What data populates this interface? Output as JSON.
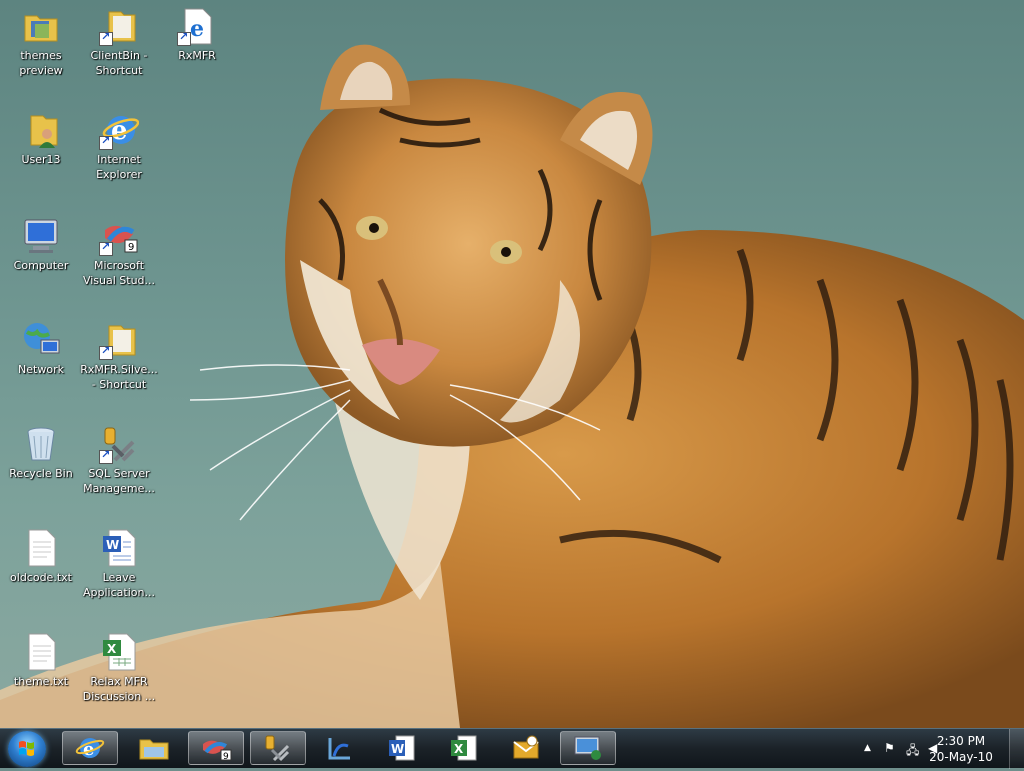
{
  "desktop": {
    "icons": [
      {
        "name": "themes preview",
        "label": "themes\npreview",
        "type": "folder"
      },
      {
        "name": "ClientBin - Shortcut",
        "label": "ClientBin -\nShortcut",
        "type": "folder-shortcut"
      },
      {
        "name": "RxMFR",
        "label": "RxMFR",
        "type": "ie-shortcut"
      },
      {
        "name": "User13",
        "label": "User13",
        "type": "user-folder"
      },
      {
        "name": "Internet Explorer",
        "label": "Internet\nExplorer",
        "type": "ie"
      },
      {
        "name": "Computer",
        "label": "Computer",
        "type": "computer"
      },
      {
        "name": "Microsoft Visual Studio",
        "label": "Microsoft\nVisual Stud...",
        "type": "vs-shortcut"
      },
      {
        "name": "Network",
        "label": "Network",
        "type": "network"
      },
      {
        "name": "RxMFR.Silve... - Shortcut",
        "label": "RxMFR.Silve...\n- Shortcut",
        "type": "folder-shortcut"
      },
      {
        "name": "Recycle Bin",
        "label": "Recycle Bin",
        "type": "recycle"
      },
      {
        "name": "SQL Server Management",
        "label": "SQL Server\nManageme...",
        "type": "sql-shortcut"
      },
      {
        "name": "oldcode.txt",
        "label": "oldcode.txt",
        "type": "txt"
      },
      {
        "name": "Leave Application",
        "label": "Leave\nApplication...",
        "type": "word"
      },
      {
        "name": "theme.txt",
        "label": "theme.txt",
        "type": "txt"
      },
      {
        "name": "Relax MFR Discussion",
        "label": "Relax MFR\nDiscussion ...",
        "type": "excel"
      }
    ]
  },
  "taskbar": {
    "buttons": [
      {
        "name": "internet-explorer",
        "color": "#2f86d8"
      },
      {
        "name": "windows-explorer",
        "color": "#e8c24a"
      },
      {
        "name": "visual-studio",
        "color": "#d9534f"
      },
      {
        "name": "sql-server",
        "color": "#c9a13a"
      },
      {
        "name": "expression-blend",
        "color": "#6aa7d9"
      },
      {
        "name": "word",
        "color": "#2b5fb8"
      },
      {
        "name": "excel",
        "color": "#2f8a3f"
      },
      {
        "name": "outlook",
        "color": "#e3a92b"
      },
      {
        "name": "remote-desktop",
        "color": "#4a90d9"
      }
    ],
    "clock": {
      "time": "2:30 PM",
      "date": "20-May-10"
    }
  },
  "colors": {
    "taskbar": "#1b2228",
    "desktop": "#6e9590",
    "label_text": "#ffffff"
  }
}
